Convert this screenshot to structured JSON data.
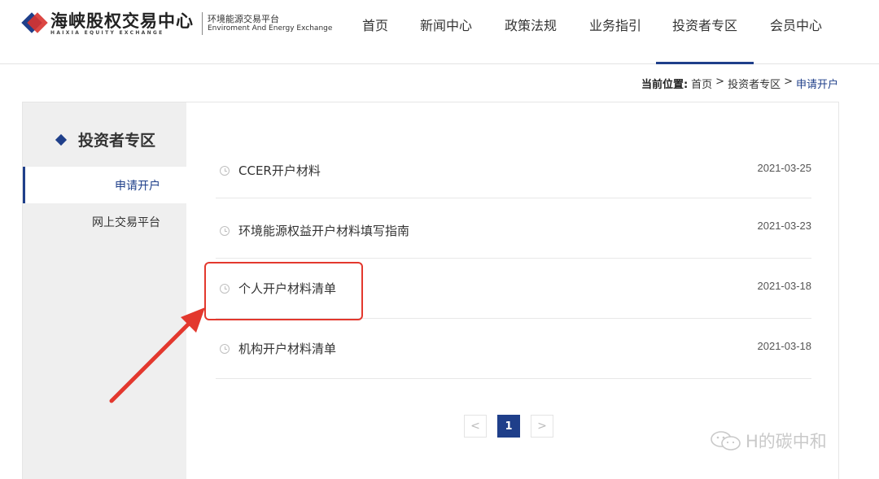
{
  "header": {
    "logo_cn": "海峡股权交易中心",
    "logo_en": "HAIXIA EQUITY EXCHANGE",
    "logo_sub_cn": "环境能源交易平台",
    "logo_sub_en": "Enviroment And Energy Exchange",
    "nav": [
      {
        "label": "首页",
        "active": false
      },
      {
        "label": "新闻中心",
        "active": false
      },
      {
        "label": "政策法规",
        "active": false
      },
      {
        "label": "业务指引",
        "active": false
      },
      {
        "label": "投资者专区",
        "active": true
      },
      {
        "label": "会员中心",
        "active": false
      }
    ]
  },
  "breadcrumb": {
    "label": "当前位置:",
    "items": [
      "首页",
      "投资者专区",
      "申请开户"
    ],
    "separator": ">"
  },
  "sidebar": {
    "title": "投资者专区",
    "items": [
      {
        "label": "申请开户",
        "active": true
      },
      {
        "label": "网上交易平台",
        "active": false
      }
    ]
  },
  "list": [
    {
      "title": "CCER开户材料",
      "date": "2021-03-25"
    },
    {
      "title": "环境能源权益开户材料填写指南",
      "date": "2021-03-23"
    },
    {
      "title": "个人开户材料清单",
      "date": "2021-03-18",
      "highlighted": true
    },
    {
      "title": "机构开户材料清单",
      "date": "2021-03-18"
    }
  ],
  "pagination": {
    "prev": "<",
    "current": "1",
    "next": ">"
  },
  "watermark": {
    "text": "H的碳中和"
  },
  "colors": {
    "brand": "#1f3f8a",
    "annotation": "#e3382e",
    "sidebar_bg": "#efefef"
  }
}
